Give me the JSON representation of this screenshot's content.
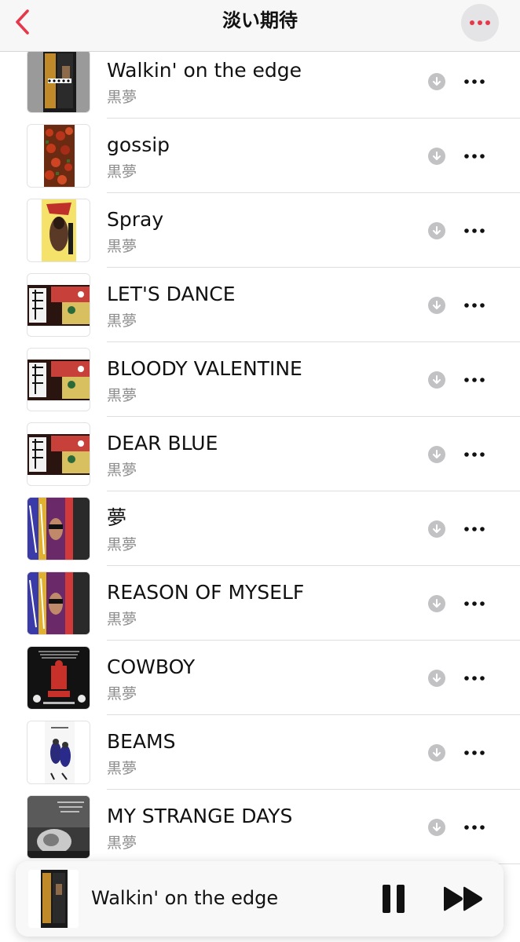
{
  "header": {
    "title": "淡い期待",
    "back_icon": "chevron-left-icon",
    "more_icon": "ellipsis-icon",
    "accent_color": "#e5384b"
  },
  "songs": [
    {
      "title": "Walkin' on the edge",
      "artist": "黒夢"
    },
    {
      "title": "gossip",
      "artist": "黒夢"
    },
    {
      "title": "Spray",
      "artist": "黒夢"
    },
    {
      "title": "LET'S DANCE",
      "artist": "黒夢"
    },
    {
      "title": "BLOODY VALENTINE",
      "artist": "黒夢"
    },
    {
      "title": "DEAR BLUE",
      "artist": "黒夢"
    },
    {
      "title": "夢",
      "artist": "黒夢"
    },
    {
      "title": "REASON OF MYSELF",
      "artist": "黒夢"
    },
    {
      "title": "COWBOY",
      "artist": "黒夢"
    },
    {
      "title": "BEAMS",
      "artist": "黒夢"
    },
    {
      "title": "MY STRANGE DAYS",
      "artist": "黒夢"
    }
  ],
  "row_icons": {
    "download": "download-icon",
    "more": "ellipsis-icon"
  },
  "now_playing": {
    "title": "Walkin' on the edge",
    "pause_icon": "pause-icon",
    "forward_icon": "fast-forward-icon"
  }
}
